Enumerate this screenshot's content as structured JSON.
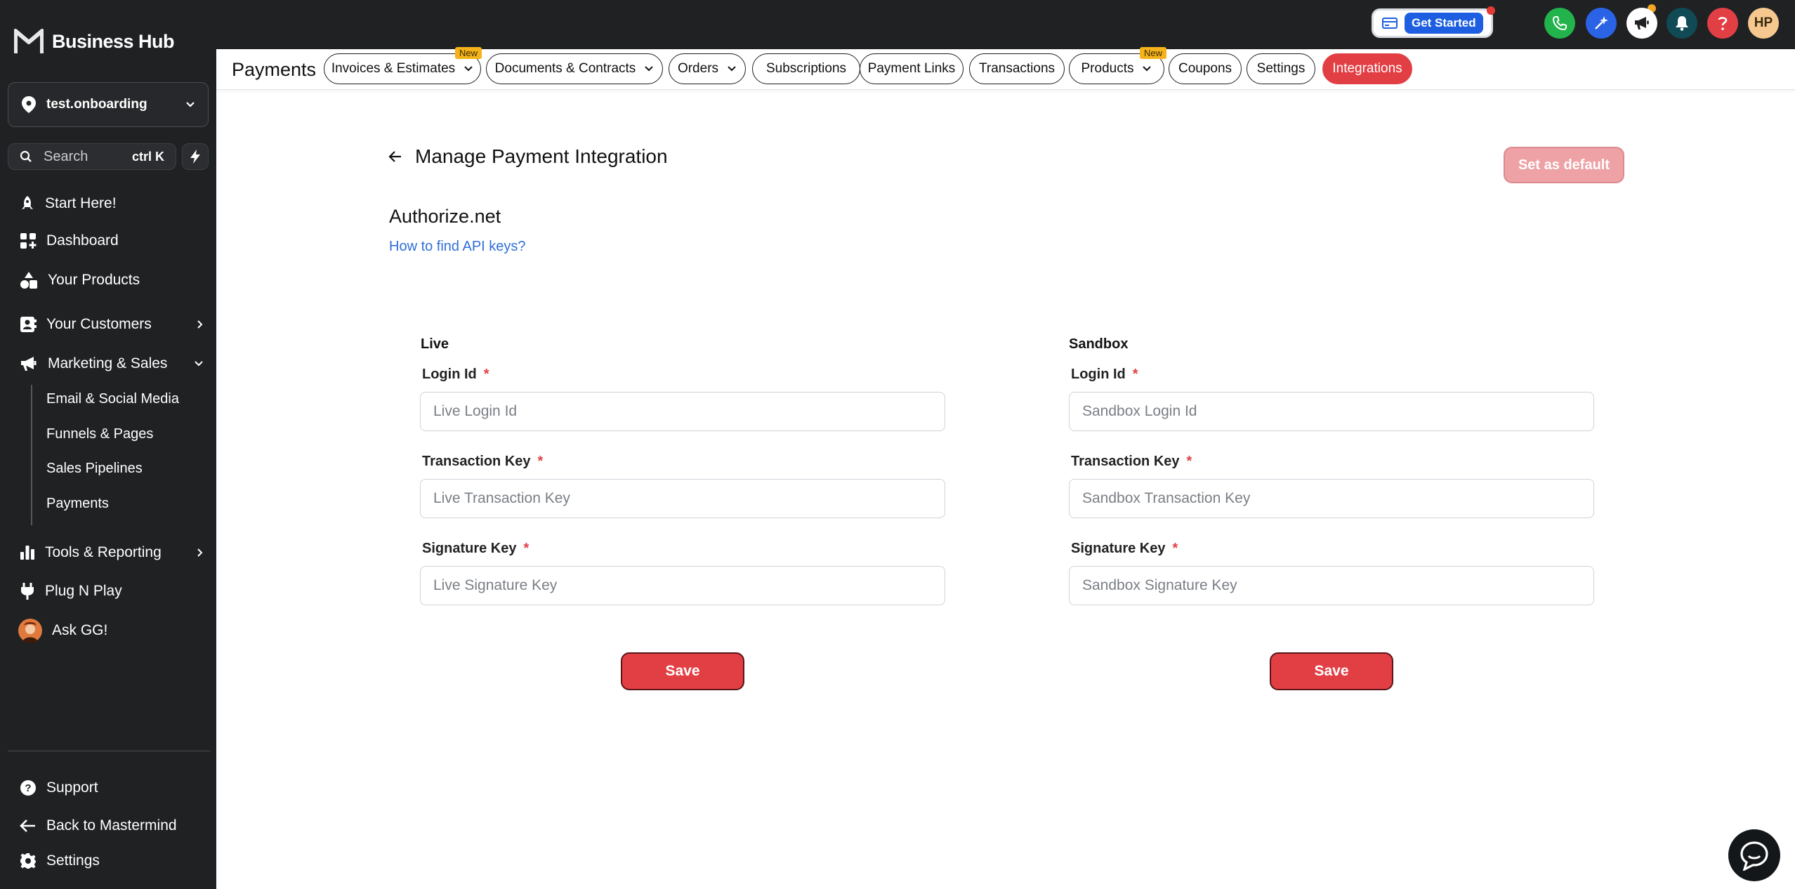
{
  "app": {
    "name": "Business Hub"
  },
  "sidebar": {
    "location": "test.onboarding",
    "search": {
      "label": "Search",
      "shortcut": "ctrl K"
    },
    "items": [
      {
        "label": "Start Here!"
      },
      {
        "label": "Dashboard"
      },
      {
        "label": "Your Products"
      },
      {
        "label": "Your Customers"
      },
      {
        "label": "Marketing & Sales"
      },
      {
        "label": "Tools & Reporting"
      },
      {
        "label": "Plug N Play"
      },
      {
        "label": "Ask GG!"
      }
    ],
    "sub_items": [
      {
        "label": "Email & Social Media"
      },
      {
        "label": "Funnels & Pages"
      },
      {
        "label": "Sales Pipelines"
      },
      {
        "label": "Payments"
      }
    ],
    "footer": [
      {
        "label": "Support"
      },
      {
        "label": "Back to Mastermind"
      },
      {
        "label": "Settings"
      }
    ]
  },
  "topbar": {
    "get_started": "Get Started",
    "avatar_initials": "HP"
  },
  "tabs": {
    "section": "Payments",
    "new_badge": "New",
    "items": [
      {
        "label": "Invoices & Estimates"
      },
      {
        "label": "Documents & Contracts"
      },
      {
        "label": "Orders"
      },
      {
        "label": "Subscriptions"
      },
      {
        "label": "Payment Links"
      },
      {
        "label": "Transactions"
      },
      {
        "label": "Products"
      },
      {
        "label": "Coupons"
      },
      {
        "label": "Settings"
      },
      {
        "label": "Integrations"
      }
    ]
  },
  "main": {
    "title": "Manage Payment Integration",
    "set_default": "Set as default",
    "provider": "Authorize.net",
    "help_link": "How to find API keys?",
    "live": {
      "title": "Live",
      "login_label": "Login Id",
      "login_placeholder": "Live Login Id",
      "txn_label": "Transaction Key",
      "txn_placeholder": "Live Transaction Key",
      "sig_label": "Signature Key",
      "sig_placeholder": "Live Signature Key",
      "save": "Save"
    },
    "sandbox": {
      "title": "Sandbox",
      "login_label": "Login Id",
      "login_placeholder": "Sandbox Login Id",
      "txn_label": "Transaction Key",
      "txn_placeholder": "Sandbox Transaction Key",
      "sig_label": "Signature Key",
      "sig_placeholder": "Sandbox Signature Key",
      "save": "Save"
    },
    "required_mark": "*"
  },
  "colors": {
    "brand_red": "#e23f45",
    "sidebar_bg": "#1f2123",
    "link_blue": "#2f6fd8"
  }
}
